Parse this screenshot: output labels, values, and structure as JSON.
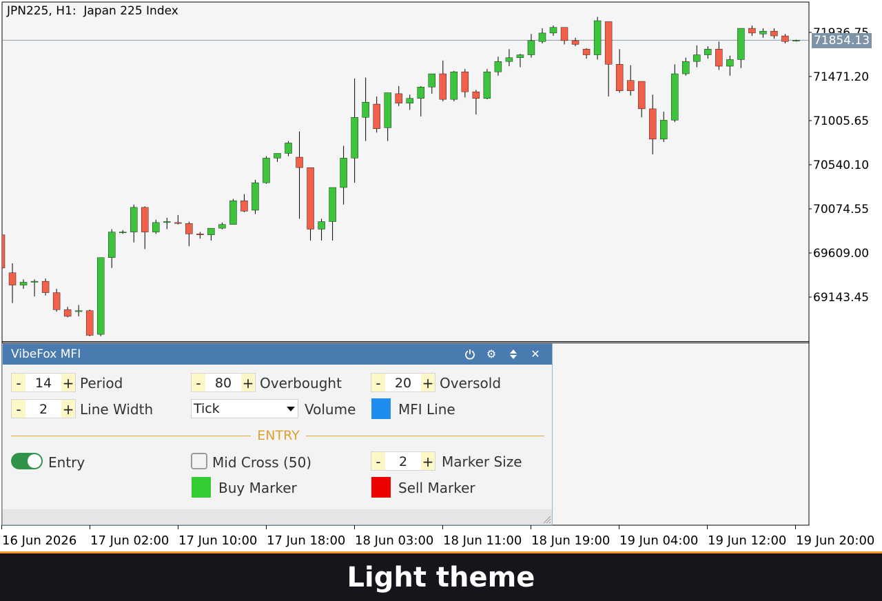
{
  "chart": {
    "title": "JPN225, H1:  Japan 225 Index",
    "current_price": "71854.13",
    "price_labels": [
      "71936.75",
      "71471.20",
      "71005.65",
      "70540.10",
      "70074.55",
      "69609.00",
      "69143.45"
    ],
    "time_labels": [
      "16 Jun 2026",
      "17 Jun 02:00",
      "17 Jun 10:00",
      "17 Jun 18:00",
      "18 Jun 03:00",
      "18 Jun 11:00",
      "18 Jun 19:00",
      "19 Jun 04:00",
      "19 Jun 12:00",
      "19 Jun 20:00"
    ],
    "colors": {
      "bull": "#3cc43c",
      "bear": "#f0604a",
      "grid": "#000000",
      "price_line": "#8a9aa8"
    }
  },
  "chart_data": {
    "type": "candlestick",
    "price_axis": [
      71936.75,
      71471.2,
      71005.65,
      70540.1,
      70074.55,
      69609.0,
      69143.45
    ],
    "current_price": 71854.13,
    "candles": [
      {
        "o": 69800,
        "h": 69800,
        "l": 69450,
        "c": 69450
      },
      {
        "o": 69400,
        "h": 69500,
        "l": 69080,
        "c": 69270
      },
      {
        "o": 69270,
        "h": 69330,
        "l": 69230,
        "c": 69300
      },
      {
        "o": 69300,
        "h": 69330,
        "l": 69150,
        "c": 69310
      },
      {
        "o": 69310,
        "h": 69340,
        "l": 69160,
        "c": 69190
      },
      {
        "o": 69190,
        "h": 69230,
        "l": 68990,
        "c": 69010
      },
      {
        "o": 69010,
        "h": 69040,
        "l": 68930,
        "c": 68940
      },
      {
        "o": 68990,
        "h": 69060,
        "l": 68940,
        "c": 69000
      },
      {
        "o": 69000,
        "h": 69010,
        "l": 68730,
        "c": 68740
      },
      {
        "o": 68750,
        "h": 69560,
        "l": 68730,
        "c": 69560
      },
      {
        "o": 69560,
        "h": 69860,
        "l": 69450,
        "c": 69830
      },
      {
        "o": 69830,
        "h": 69850,
        "l": 69810,
        "c": 69830
      },
      {
        "o": 69830,
        "h": 70120,
        "l": 69720,
        "c": 70090
      },
      {
        "o": 70090,
        "h": 70100,
        "l": 69650,
        "c": 69830
      },
      {
        "o": 69830,
        "h": 69960,
        "l": 69810,
        "c": 69930
      },
      {
        "o": 69930,
        "h": 69980,
        "l": 69860,
        "c": 69940
      },
      {
        "o": 69930,
        "h": 70010,
        "l": 69910,
        "c": 69920
      },
      {
        "o": 69920,
        "h": 69940,
        "l": 69680,
        "c": 69810
      },
      {
        "o": 69810,
        "h": 69830,
        "l": 69760,
        "c": 69800
      },
      {
        "o": 69800,
        "h": 69870,
        "l": 69740,
        "c": 69870
      },
      {
        "o": 69870,
        "h": 69930,
        "l": 69860,
        "c": 69910
      },
      {
        "o": 69910,
        "h": 70180,
        "l": 69910,
        "c": 70160
      },
      {
        "o": 70160,
        "h": 70230,
        "l": 70040,
        "c": 70050
      },
      {
        "o": 70060,
        "h": 70380,
        "l": 70020,
        "c": 70350
      },
      {
        "o": 70350,
        "h": 70630,
        "l": 70340,
        "c": 70610
      },
      {
        "o": 70610,
        "h": 70650,
        "l": 70570,
        "c": 70660
      },
      {
        "o": 70660,
        "h": 70790,
        "l": 70630,
        "c": 70770
      },
      {
        "o": 70620,
        "h": 70890,
        "l": 69970,
        "c": 70510
      },
      {
        "o": 70510,
        "h": 70510,
        "l": 69740,
        "c": 69860
      },
      {
        "o": 69860,
        "h": 69970,
        "l": 69740,
        "c": 69940
      },
      {
        "o": 69940,
        "h": 70220,
        "l": 69740,
        "c": 70300
      },
      {
        "o": 70300,
        "h": 70740,
        "l": 70120,
        "c": 70610
      },
      {
        "o": 70610,
        "h": 71450,
        "l": 70350,
        "c": 71040
      },
      {
        "o": 71040,
        "h": 71460,
        "l": 70790,
        "c": 71200
      },
      {
        "o": 71180,
        "h": 71260,
        "l": 70880,
        "c": 70920
      },
      {
        "o": 70930,
        "h": 71230,
        "l": 70790,
        "c": 71300
      },
      {
        "o": 71290,
        "h": 71370,
        "l": 71160,
        "c": 71190
      },
      {
        "o": 71190,
        "h": 71280,
        "l": 71120,
        "c": 71240
      },
      {
        "o": 71240,
        "h": 71370,
        "l": 71050,
        "c": 71360
      },
      {
        "o": 71360,
        "h": 71430,
        "l": 71290,
        "c": 71500
      },
      {
        "o": 71500,
        "h": 71640,
        "l": 71210,
        "c": 71230
      },
      {
        "o": 71230,
        "h": 71530,
        "l": 71210,
        "c": 71520
      },
      {
        "o": 71520,
        "h": 71550,
        "l": 71250,
        "c": 71310
      },
      {
        "o": 71310,
        "h": 71330,
        "l": 71070,
        "c": 71240
      },
      {
        "o": 71240,
        "h": 71550,
        "l": 71230,
        "c": 71520
      },
      {
        "o": 71520,
        "h": 71680,
        "l": 71480,
        "c": 71630
      },
      {
        "o": 71630,
        "h": 71760,
        "l": 71580,
        "c": 71670
      },
      {
        "o": 71670,
        "h": 71710,
        "l": 71570,
        "c": 71700
      },
      {
        "o": 71700,
        "h": 71920,
        "l": 71670,
        "c": 71850
      },
      {
        "o": 71840,
        "h": 71980,
        "l": 71820,
        "c": 71930
      },
      {
        "o": 71930,
        "h": 72010,
        "l": 71900,
        "c": 71990
      },
      {
        "o": 71990,
        "h": 71990,
        "l": 71810,
        "c": 71850
      },
      {
        "o": 71850,
        "h": 71880,
        "l": 71790,
        "c": 71810
      },
      {
        "o": 71760,
        "h": 71770,
        "l": 71660,
        "c": 71700
      },
      {
        "o": 71700,
        "h": 72100,
        "l": 71650,
        "c": 72060
      },
      {
        "o": 72050,
        "h": 72050,
        "l": 71260,
        "c": 71600
      },
      {
        "o": 71600,
        "h": 71760,
        "l": 71300,
        "c": 71320
      },
      {
        "o": 71430,
        "h": 71590,
        "l": 71270,
        "c": 71320
      },
      {
        "o": 71420,
        "h": 71420,
        "l": 71040,
        "c": 71130
      },
      {
        "o": 71130,
        "h": 71280,
        "l": 70650,
        "c": 70810
      },
      {
        "o": 70810,
        "h": 71100,
        "l": 70780,
        "c": 71010
      },
      {
        "o": 71010,
        "h": 71600,
        "l": 70990,
        "c": 71500
      },
      {
        "o": 71500,
        "h": 71670,
        "l": 71480,
        "c": 71630
      },
      {
        "o": 71630,
        "h": 71800,
        "l": 71570,
        "c": 71700
      },
      {
        "o": 71700,
        "h": 71790,
        "l": 71660,
        "c": 71760
      },
      {
        "o": 71760,
        "h": 71840,
        "l": 71540,
        "c": 71580
      },
      {
        "o": 71580,
        "h": 71690,
        "l": 71480,
        "c": 71650
      },
      {
        "o": 71650,
        "h": 71980,
        "l": 71560,
        "c": 71980
      },
      {
        "o": 71980,
        "h": 72010,
        "l": 71900,
        "c": 71930
      },
      {
        "o": 71920,
        "h": 71980,
        "l": 71880,
        "c": 71950
      },
      {
        "o": 71950,
        "h": 71980,
        "l": 71870,
        "c": 71900
      },
      {
        "o": 71900,
        "h": 71920,
        "l": 71820,
        "c": 71840
      },
      {
        "o": 71850,
        "h": 71860,
        "l": 71840,
        "c": 71854
      }
    ]
  },
  "panel": {
    "title": "VibeFox MFI",
    "header_icons": [
      "power-icon",
      "gear-icon",
      "move-icon",
      "close-icon"
    ],
    "period": {
      "minus": "-",
      "value": "14",
      "plus": "+",
      "label": "Period"
    },
    "overbought": {
      "minus": "-",
      "value": "80",
      "plus": "+",
      "label": "Overbought"
    },
    "oversold": {
      "minus": "-",
      "value": "20",
      "plus": "+",
      "label": "Oversold"
    },
    "line_width": {
      "minus": "-",
      "value": "2",
      "plus": "+",
      "label": "Line Width"
    },
    "volume": {
      "selected": "Tick",
      "label": "Volume"
    },
    "mfi_line": {
      "label": "MFI Line",
      "color": "#1e8cf0"
    },
    "entry_section": "ENTRY",
    "entry": {
      "label": "Entry",
      "on": true
    },
    "mid_cross": {
      "label": "Mid Cross (50)",
      "checked": false
    },
    "marker_size": {
      "minus": "-",
      "value": "2",
      "plus": "+",
      "label": "Marker Size"
    },
    "buy_marker": {
      "label": "Buy Marker",
      "color": "#33cc33"
    },
    "sell_marker": {
      "label": "Sell Marker",
      "color": "#ee0000"
    }
  },
  "banner": {
    "text": "Light theme"
  }
}
